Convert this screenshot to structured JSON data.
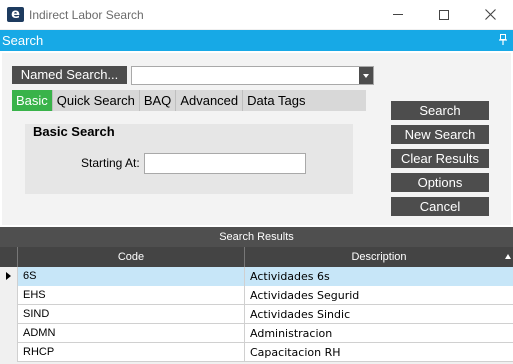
{
  "window": {
    "title": "Indirect Labor Search",
    "icon_letter": "e"
  },
  "search_header": {
    "label": "Search"
  },
  "named_search": {
    "button_label": "Named Search...",
    "value": ""
  },
  "tabs": [
    {
      "label": "Basic",
      "active": true
    },
    {
      "label": "Quick Search",
      "active": false
    },
    {
      "label": "BAQ",
      "active": false
    },
    {
      "label": "Advanced",
      "active": false
    },
    {
      "label": "Data Tags",
      "active": false
    }
  ],
  "basic_search": {
    "title": "Basic Search",
    "starting_at_label": "Starting At:",
    "starting_at_value": ""
  },
  "actions": {
    "search": "Search",
    "new_search": "New Search",
    "clear_results": "Clear Results",
    "options": "Options",
    "cancel": "Cancel"
  },
  "results": {
    "title": "Search Results",
    "columns": {
      "code": "Code",
      "description": "Description"
    },
    "rows": [
      {
        "code": "6S",
        "description": "Actividades 6s",
        "selected": true
      },
      {
        "code": "EHS",
        "description": "Actividades Segurid",
        "selected": false
      },
      {
        "code": "SIND",
        "description": "Actividades Sindic",
        "selected": false
      },
      {
        "code": "ADMN",
        "description": "Administracion",
        "selected": false
      },
      {
        "code": "RHCP",
        "description": "Capacitacion RH",
        "selected": false
      }
    ]
  },
  "colors": {
    "accent_blue": "#17a9e6",
    "active_tab_green": "#39b34a",
    "button_dark": "#4d4d4d",
    "selected_row": "#c7e6f8"
  }
}
